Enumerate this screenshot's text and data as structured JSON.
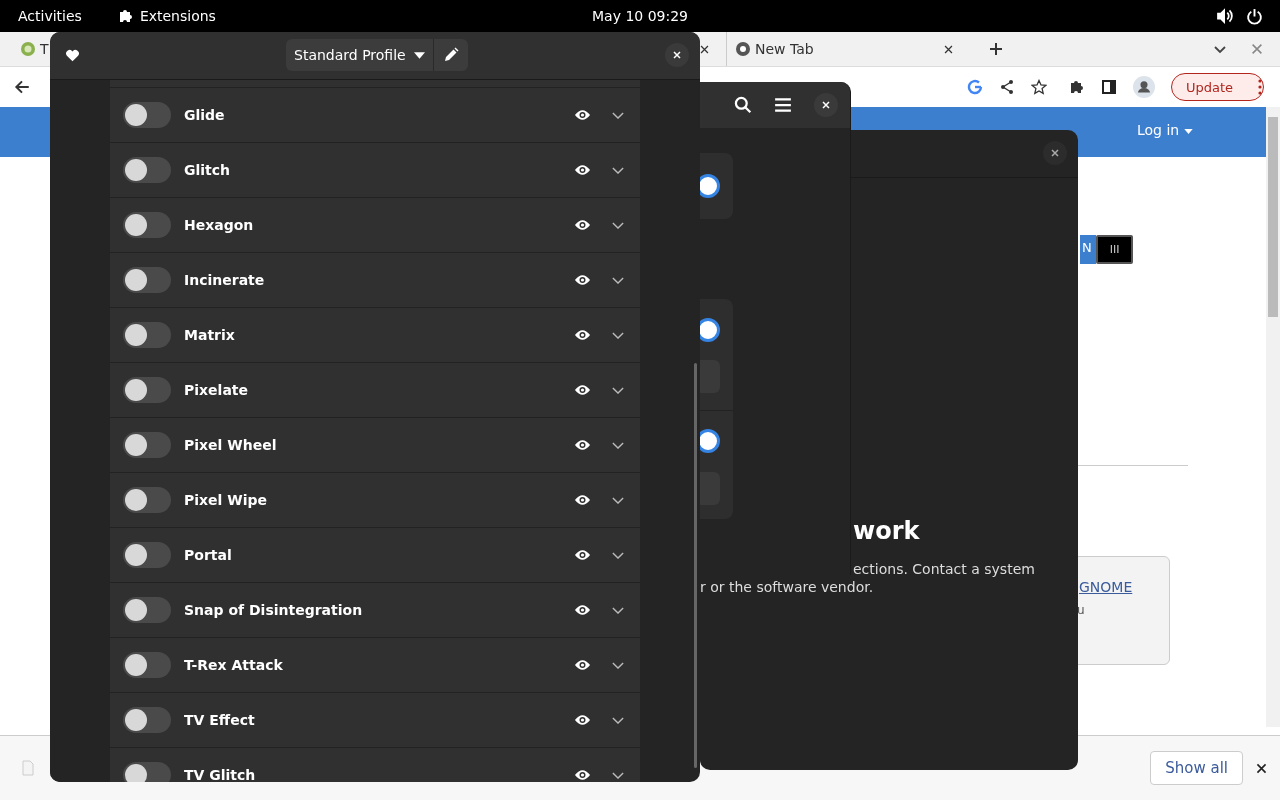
{
  "top_bar": {
    "activities": "Activities",
    "app_menu": "Extensions",
    "clock": "May 10  09:29"
  },
  "browser": {
    "tabs": [
      {
        "title": "T"
      },
      {
        "title": "New Tab"
      }
    ],
    "update_button": "Update",
    "page": {
      "login": "Log in",
      "toggle_left": "N",
      "toggle_right": "III",
      "link": "GNOME",
      "card_text": "u"
    },
    "download_bar": {
      "show_all": "Show all"
    }
  },
  "dialog": {
    "title": "work",
    "lines": [
      "ections. Contact a system",
      "r or the software vendor."
    ]
  },
  "settings_window": {
    "switches": [
      {
        "on": true
      },
      {
        "on": true
      },
      {
        "on": true
      }
    ]
  },
  "effects_window": {
    "profile": "Standard Profile",
    "effects": [
      {
        "name": "Glide",
        "enabled": false
      },
      {
        "name": "Glitch",
        "enabled": false
      },
      {
        "name": "Hexagon",
        "enabled": false
      },
      {
        "name": "Incinerate",
        "enabled": false
      },
      {
        "name": "Matrix",
        "enabled": false
      },
      {
        "name": "Pixelate",
        "enabled": false
      },
      {
        "name": "Pixel Wheel",
        "enabled": false
      },
      {
        "name": "Pixel Wipe",
        "enabled": false
      },
      {
        "name": "Portal",
        "enabled": false
      },
      {
        "name": "Snap of Disintegration",
        "enabled": false
      },
      {
        "name": "T-Rex Attack",
        "enabled": false
      },
      {
        "name": "TV Effect",
        "enabled": false
      },
      {
        "name": "TV Glitch",
        "enabled": false
      }
    ]
  }
}
